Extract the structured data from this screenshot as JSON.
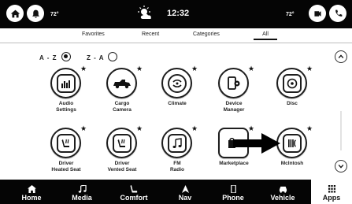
{
  "status": {
    "left_temp": "72°",
    "right_temp": "72°",
    "clock": "12:32"
  },
  "tabs": [
    {
      "label": "Favorites"
    },
    {
      "label": "Recent"
    },
    {
      "label": "Categories"
    },
    {
      "label": "All"
    }
  ],
  "sort": {
    "az_label": "A - Z",
    "za_label": "Z - A",
    "selected": "A - Z"
  },
  "apps": [
    {
      "label": "Audio\nSettings",
      "icon": "audio-settings-icon"
    },
    {
      "label": "Cargo\nCamera",
      "icon": "cargo-camera-icon"
    },
    {
      "label": "Climate",
      "icon": "climate-icon"
    },
    {
      "label": "Device\nManager",
      "icon": "device-manager-icon"
    },
    {
      "label": "Disc",
      "icon": "disc-icon"
    },
    {
      "label": "Driver\nHeated Seat",
      "icon": "heated-seat-icon"
    },
    {
      "label": "Driver\nVented Seat",
      "icon": "vented-seat-icon"
    },
    {
      "label": "FM\nRadio",
      "icon": "music-note-icon"
    },
    {
      "label": "Marketplace",
      "icon": "marketplace-icon"
    },
    {
      "label": "McIntosh",
      "icon": "mcintosh-icon"
    }
  ],
  "nav": [
    {
      "label": "Home",
      "icon": "home-icon"
    },
    {
      "label": "Media",
      "icon": "music-note-icon"
    },
    {
      "label": "Comfort",
      "icon": "seat-icon"
    },
    {
      "label": "Nav",
      "icon": "navigation-arrow-icon"
    },
    {
      "label": "Phone",
      "icon": "phone-icon"
    },
    {
      "label": "Vehicle",
      "icon": "car-icon"
    },
    {
      "label": "Apps",
      "icon": "apps-grid-icon"
    }
  ],
  "colors": {
    "bar_background": "#050505",
    "active_nav_background": "#ffffff"
  }
}
